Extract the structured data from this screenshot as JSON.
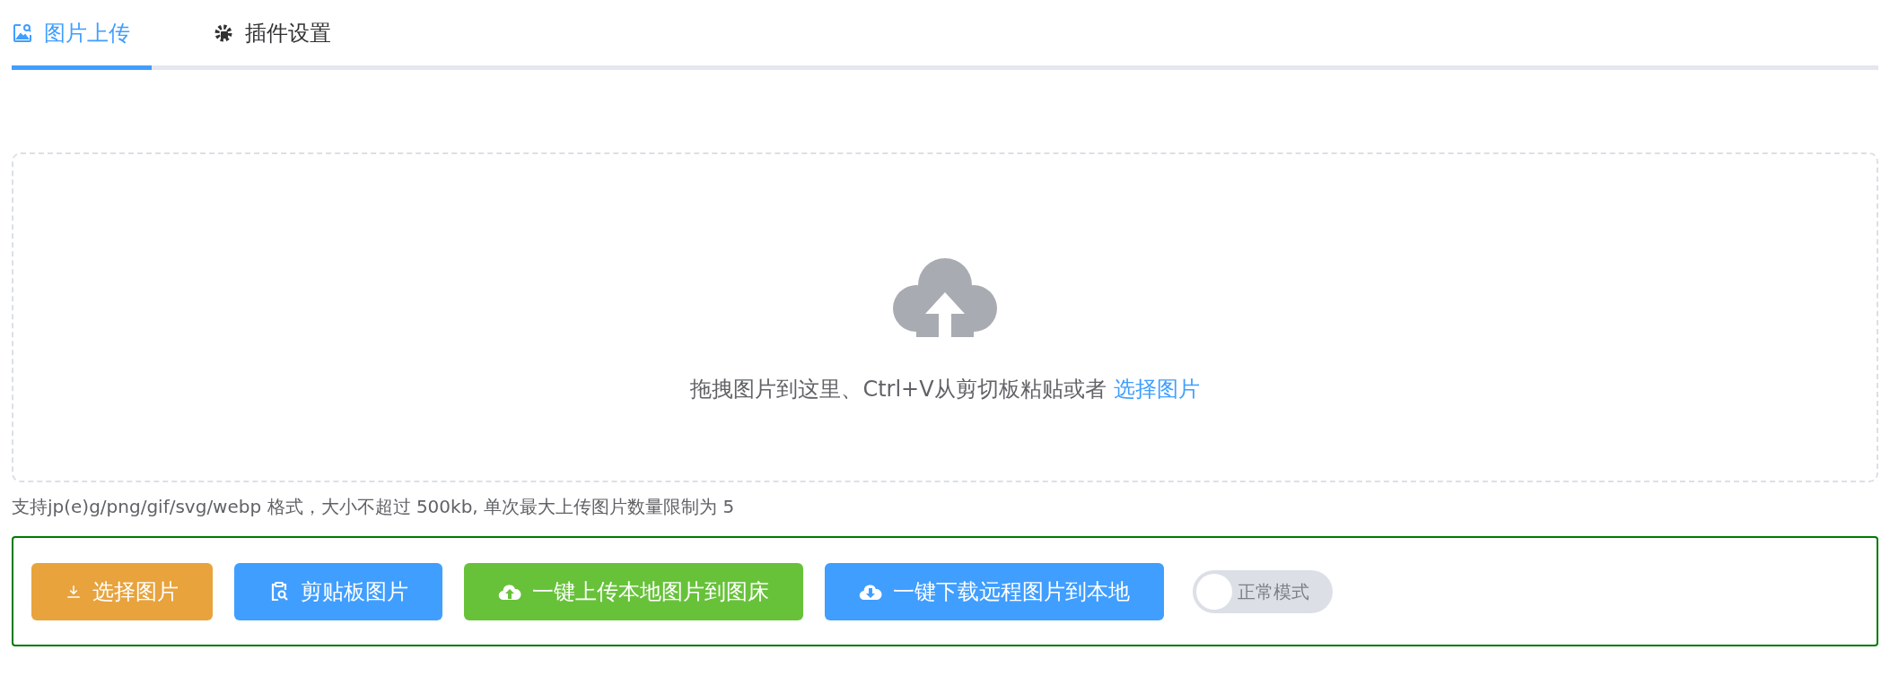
{
  "tabs": [
    {
      "label": "图片上传",
      "selected": true
    },
    {
      "label": "插件设置",
      "selected": false
    }
  ],
  "dropzone": {
    "text": "拖拽图片到这里、Ctrl+V从剪切板粘贴或者",
    "link": "选择图片"
  },
  "hint": "支持jp(e)g/png/gif/svg/webp 格式，大小不超过 500kb, 单次最大上传图片数量限制为 5",
  "buttons": [
    {
      "label": "选择图片",
      "color": "#e8a33d"
    },
    {
      "label": "剪贴板图片",
      "color": "#409eff"
    },
    {
      "label": "一键上传本地图片到图床",
      "color": "#67c23a"
    },
    {
      "label": "一键下载远程图片到本地",
      "color": "#409eff"
    }
  ],
  "mode_switch": {
    "label": "正常模式",
    "on": false
  }
}
